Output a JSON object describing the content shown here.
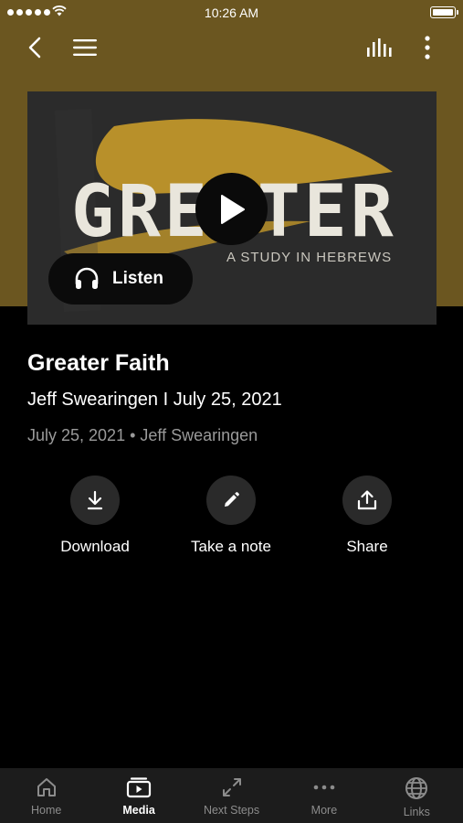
{
  "status": {
    "time": "10:26 AM"
  },
  "nav": {
    "back_icon": "chevron-left-icon",
    "menu_icon": "hamburger-menu-icon",
    "levels_icon": "audio-levels-icon",
    "more_icon": "vertical-ellipsis-icon"
  },
  "artwork": {
    "title": "GREATER",
    "subtitle": "A STUDY IN HEBREWS",
    "brush_color": "#b8902a"
  },
  "player": {
    "listen_label": "Listen"
  },
  "media": {
    "title": "Greater Faith",
    "subtitle": "Jeff Swearingen I July 25, 2021",
    "meta": "July 25, 2021 • Jeff Swearingen"
  },
  "actions": [
    {
      "label": "Download",
      "icon": "download-icon"
    },
    {
      "label": "Take a note",
      "icon": "pencil-icon"
    },
    {
      "label": "Share",
      "icon": "share-icon"
    }
  ],
  "tabs": [
    {
      "label": "Home",
      "icon": "home-icon"
    },
    {
      "label": "Media",
      "icon": "media-icon",
      "active": true
    },
    {
      "label": "Next Steps",
      "icon": "next-steps-icon"
    },
    {
      "label": "More",
      "icon": "more-icon"
    },
    {
      "label": "Links",
      "icon": "globe-icon"
    }
  ],
  "colors": {
    "header_band": "#6b5620",
    "background": "#000000",
    "tab_bar": "#1c1c1c",
    "action_circle": "#2a2a2a"
  }
}
